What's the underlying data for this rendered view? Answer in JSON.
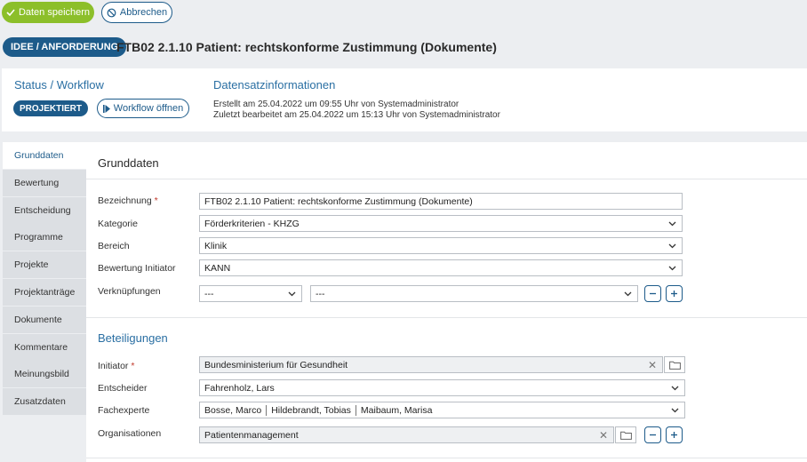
{
  "toolbar": {
    "save_label": "Daten speichern",
    "cancel_label": "Abbrechen"
  },
  "header": {
    "type_badge": "IDEE / ANFORDERUNG",
    "title": "FTB02 2.1.10 Patient: rechtskonforme Zustimmung (Dokumente)"
  },
  "status": {
    "heading": "Status / Workflow",
    "state_badge": "PROJEKTIERT",
    "workflow_button": "Workflow öffnen",
    "record_heading": "Datensatzinformationen",
    "created": "Erstellt am 25.04.2022 um 09:55 Uhr von Systemadministrator",
    "edited": "Zuletzt bearbeitet am 25.04.2022 um 15:13 Uhr von Systemadministrator"
  },
  "nav": {
    "items": [
      {
        "label": "Grunddaten"
      },
      {
        "label": "Bewertung"
      },
      {
        "label": "Entscheidung"
      },
      {
        "label": "Programme"
      },
      {
        "label": "Projekte"
      },
      {
        "label": "Projektanträge"
      },
      {
        "label": "Dokumente"
      },
      {
        "label": "Kommentare"
      },
      {
        "label": "Meinungsbild"
      },
      {
        "label": "Zusatzdaten"
      }
    ]
  },
  "grunddaten": {
    "title": "Grunddaten",
    "bezeichnung_label": "Bezeichnung",
    "bezeichnung_value": "FTB02 2.1.10 Patient: rechtskonforme Zustimmung (Dokumente)",
    "kategorie_label": "Kategorie",
    "kategorie_value": "Förderkriterien - KHZG",
    "bereich_label": "Bereich",
    "bereich_value": "Klinik",
    "bewertung_label": "Bewertung Initiator",
    "bewertung_value": "KANN",
    "verknuepfungen_label": "Verknüpfungen",
    "verknuepfung_type_value": "---",
    "verknuepfung_target_value": "---",
    "required_marker": "*"
  },
  "beteiligungen": {
    "title": "Beteiligungen",
    "initiator_label": "Initiator",
    "initiator_value": "Bundesministerium für Gesundheit",
    "entscheider_label": "Entscheider",
    "entscheider_value": "Fahrenholz, Lars",
    "fachexperte_label": "Fachexperte",
    "fachexperte_values": [
      "Bosse, Marco",
      "Hildebrandt, Tobias",
      "Maibaum, Marisa"
    ],
    "organisationen_label": "Organisationen",
    "organisationen_value": "Patientenmanagement"
  },
  "colors": {
    "primary": "#1d5b8a",
    "save_green": "#8cbf2a",
    "required_red": "#c0392b",
    "heading_blue": "#2a6fa3"
  },
  "icons": {
    "save": "check-icon",
    "cancel": "ban-icon",
    "workflow": "play-step-icon",
    "dropdown": "chevron-down-icon",
    "clear": "close-icon",
    "browse": "folder-icon",
    "remove": "minus-icon",
    "add": "plus-icon"
  }
}
